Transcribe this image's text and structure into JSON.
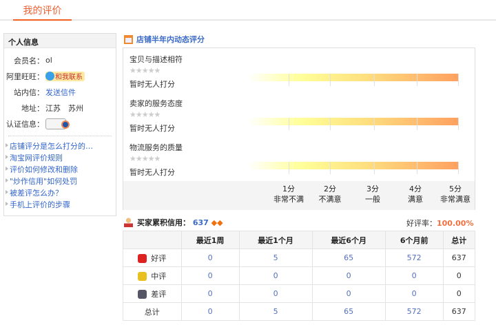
{
  "tab": "我的评价",
  "profile": {
    "header": "个人信息",
    "member_label": "会员名：",
    "member": "ol",
    "ww_label": "阿里旺旺：",
    "ww_btn": "和我联系",
    "msg_label": "站内信：",
    "msg_link": "发送信件",
    "addr_label": "地址：",
    "addr": "江苏　苏州",
    "cert_label": "认证信息："
  },
  "help_links": [
    "店铺评分是怎么打分的…",
    "淘宝网评价规则",
    "评价如何修改和删除",
    "\"炒作信用\"如何处罚",
    "被差评怎么办？",
    "手机上评价的步骤"
  ],
  "ratings": {
    "title": "店铺半年内动态评分",
    "items": [
      {
        "name": "宝贝与描述相符",
        "stars": "★★★★★",
        "status": "暂时无人打分"
      },
      {
        "name": "卖家的服务态度",
        "stars": "★★★★★",
        "status": "暂时无人打分"
      },
      {
        "name": "物流服务的质量",
        "stars": "★★★★★",
        "status": "暂时无人打分"
      }
    ],
    "scale": [
      {
        "score": "1分",
        "label": "非常不满"
      },
      {
        "score": "2分",
        "label": "不满意"
      },
      {
        "score": "3分",
        "label": "一般"
      },
      {
        "score": "4分",
        "label": "满意"
      },
      {
        "score": "5分",
        "label": "非常满意"
      }
    ]
  },
  "credit": {
    "label": "买家累积信用：",
    "value": "637",
    "rate_label": "好评率：",
    "rate": "100.00%"
  },
  "table": {
    "headers": [
      "",
      "最近1周",
      "最近1个月",
      "最近6个月",
      "6个月前",
      "总计"
    ],
    "rows": [
      {
        "label": "好评",
        "icon": "red-flower",
        "values": [
          "0",
          "5",
          "65",
          "572",
          "637"
        ]
      },
      {
        "label": "中评",
        "icon": "yellow-flower",
        "values": [
          "0",
          "0",
          "0",
          "0",
          "0"
        ]
      },
      {
        "label": "差评",
        "icon": "gray-flower",
        "values": [
          "0",
          "0",
          "0",
          "0",
          "0"
        ]
      },
      {
        "label": "总计",
        "values": [
          "0",
          "5",
          "65",
          "572",
          "637"
        ]
      }
    ]
  }
}
